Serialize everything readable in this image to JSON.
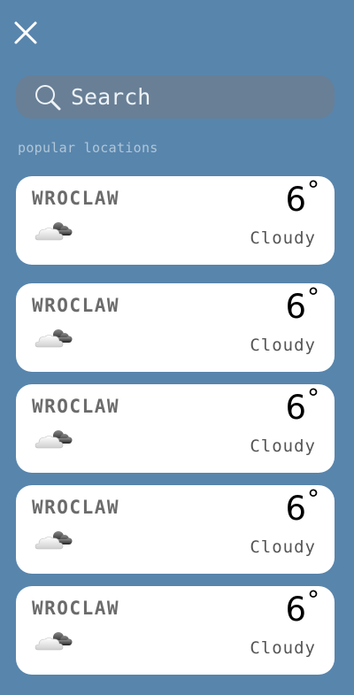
{
  "search": {
    "placeholder": "Search",
    "icon": "search-icon"
  },
  "close_icon": "close-icon",
  "section_label": "popular locations",
  "locations": [
    {
      "city": "WROCLAW",
      "temp": "6",
      "degree": "°",
      "condition": "Cloudy",
      "icon": "cloudy-icon"
    },
    {
      "city": "WROCLAW",
      "temp": "6",
      "degree": "°",
      "condition": "Cloudy",
      "icon": "cloudy-icon"
    },
    {
      "city": "WROCLAW",
      "temp": "6",
      "degree": "°",
      "condition": "Cloudy",
      "icon": "cloudy-icon"
    },
    {
      "city": "WROCLAW",
      "temp": "6",
      "degree": "°",
      "condition": "Cloudy",
      "icon": "cloudy-icon"
    },
    {
      "city": "WROCLAW",
      "temp": "6",
      "degree": "°",
      "condition": "Cloudy",
      "icon": "cloudy-icon"
    }
  ],
  "colors": {
    "background": "#5885ac",
    "search_bg": "#687f96",
    "card_bg": "#ffffff",
    "label": "#b1c6d8"
  }
}
